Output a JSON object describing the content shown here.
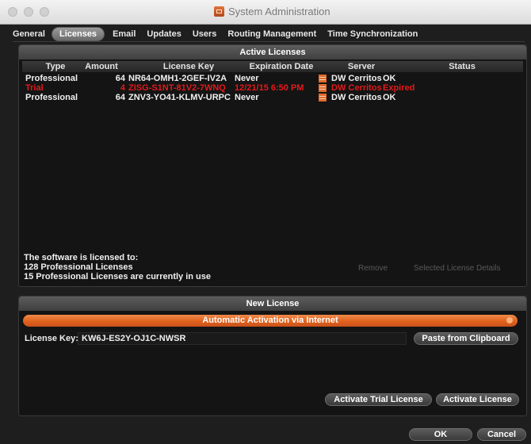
{
  "window": {
    "title": "System Administration"
  },
  "tabs": [
    {
      "label": "General"
    },
    {
      "label": "Licenses"
    },
    {
      "label": "Email"
    },
    {
      "label": "Updates"
    },
    {
      "label": "Users"
    },
    {
      "label": "Routing Management"
    },
    {
      "label": "Time Synchronization"
    }
  ],
  "active_licenses": {
    "header": "Active Licenses",
    "columns": [
      "Type",
      "Amount",
      "License Key",
      "Expiration Date",
      "Server",
      "Status"
    ],
    "rows": [
      {
        "type": "Professional",
        "amount": "64",
        "key": "NR64-OMH1-2GEF-IV2A",
        "expiration": "Never",
        "server": "DW Cerritos",
        "status": "OK"
      },
      {
        "type": "Trial",
        "amount": "4",
        "key": "ZISG-S1NT-81V2-7WNQ",
        "expiration": "12/21/15 6:50 PM",
        "server": "DW Cerritos",
        "status": "Expired"
      },
      {
        "type": "Professional",
        "amount": "64",
        "key": "ZNV3-YO41-KLMV-URPC",
        "expiration": "Never",
        "server": "DW Cerritos",
        "status": "OK"
      }
    ],
    "info": [
      "The software is licensed to:",
      "128 Professional Licenses",
      "15 Professional Licenses are currently in use"
    ],
    "remove_label": "Remove",
    "details_label": "Selected License Details"
  },
  "new_license": {
    "header": "New License",
    "activation_method": "Automatic Activation via Internet",
    "key_label": "License Key:",
    "key_value": "KW6J-ES2Y-OJ1C-NWSR",
    "paste_label": "Paste from Clipboard",
    "trial_label": "Activate Trial License",
    "activate_label": "Activate License"
  },
  "footer": {
    "ok_label": "OK",
    "cancel_label": "Cancel"
  },
  "colors": {
    "accent": "#e0621e",
    "expired": "#e21a1a",
    "background": "#1e1e1e"
  }
}
